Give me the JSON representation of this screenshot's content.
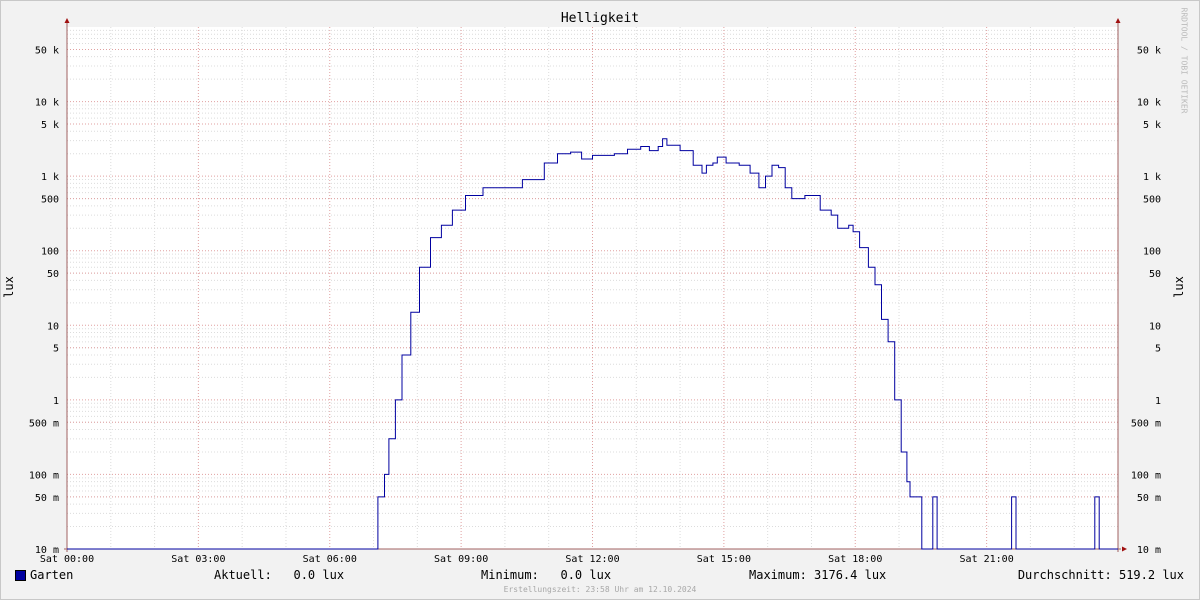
{
  "chart_data": {
    "type": "line",
    "title": "Helligkeit",
    "ylabel": "lux",
    "y_scale": "log",
    "ylim": [
      0.01,
      100000
    ],
    "y_ticks": [
      {
        "v": 0.01,
        "label": "10 m"
      },
      {
        "v": 0.05,
        "label": "50 m"
      },
      {
        "v": 0.1,
        "label": "100 m"
      },
      {
        "v": 0.5,
        "label": "500 m"
      },
      {
        "v": 1,
        "label": "1"
      },
      {
        "v": 5,
        "label": "5"
      },
      {
        "v": 10,
        "label": "10"
      },
      {
        "v": 50,
        "label": "50"
      },
      {
        "v": 100,
        "label": "100"
      },
      {
        "v": 500,
        "label": "500"
      },
      {
        "v": 1000,
        "label": "1 k"
      },
      {
        "v": 5000,
        "label": "5 k"
      },
      {
        "v": 10000,
        "label": "10 k"
      },
      {
        "v": 50000,
        "label": "50 k"
      }
    ],
    "x_unit": "hours",
    "xlim": [
      0,
      24
    ],
    "x_ticks": [
      {
        "v": 0,
        "label": "Sat 00:00"
      },
      {
        "v": 3,
        "label": "Sat 03:00"
      },
      {
        "v": 6,
        "label": "Sat 06:00"
      },
      {
        "v": 9,
        "label": "Sat 09:00"
      },
      {
        "v": 12,
        "label": "Sat 12:00"
      },
      {
        "v": 15,
        "label": "Sat 15:00"
      },
      {
        "v": 18,
        "label": "Sat 18:00"
      },
      {
        "v": 21,
        "label": "Sat 21:00"
      }
    ],
    "grid": true,
    "series": [
      {
        "name": "Garten",
        "color": "#0000a0",
        "points": [
          [
            0,
            0.01
          ],
          [
            7.08,
            0.01
          ],
          [
            7.1,
            0.05
          ],
          [
            7.2,
            0.05
          ],
          [
            7.25,
            0.1
          ],
          [
            7.35,
            0.3
          ],
          [
            7.5,
            1
          ],
          [
            7.65,
            4
          ],
          [
            7.85,
            15
          ],
          [
            8.05,
            60
          ],
          [
            8.3,
            150
          ],
          [
            8.55,
            220
          ],
          [
            8.8,
            350
          ],
          [
            9.1,
            550
          ],
          [
            9.5,
            700
          ],
          [
            10,
            700
          ],
          [
            10.4,
            900
          ],
          [
            10.9,
            1500
          ],
          [
            11.2,
            2000
          ],
          [
            11.5,
            2100
          ],
          [
            11.75,
            1700
          ],
          [
            12,
            1900
          ],
          [
            12.5,
            2000
          ],
          [
            12.8,
            2300
          ],
          [
            13.1,
            2500
          ],
          [
            13.3,
            2200
          ],
          [
            13.5,
            2500
          ],
          [
            13.6,
            3176
          ],
          [
            13.7,
            2600
          ],
          [
            14,
            2200
          ],
          [
            14.3,
            1400
          ],
          [
            14.5,
            1100
          ],
          [
            14.6,
            1400
          ],
          [
            14.75,
            1500
          ],
          [
            14.85,
            1800
          ],
          [
            15.05,
            1500
          ],
          [
            15.35,
            1400
          ],
          [
            15.6,
            1100
          ],
          [
            15.8,
            700
          ],
          [
            15.95,
            1000
          ],
          [
            16.1,
            1400
          ],
          [
            16.25,
            1300
          ],
          [
            16.4,
            700
          ],
          [
            16.55,
            500
          ],
          [
            16.85,
            550
          ],
          [
            17.2,
            350
          ],
          [
            17.45,
            300
          ],
          [
            17.6,
            200
          ],
          [
            17.85,
            220
          ],
          [
            17.95,
            180
          ],
          [
            18.1,
            110
          ],
          [
            18.3,
            60
          ],
          [
            18.45,
            35
          ],
          [
            18.6,
            12
          ],
          [
            18.75,
            6
          ],
          [
            18.9,
            1
          ],
          [
            19.05,
            0.2
          ],
          [
            19.18,
            0.08
          ],
          [
            19.25,
            0.05
          ],
          [
            19.5,
            0.05
          ],
          [
            19.52,
            0.01
          ],
          [
            19.75,
            0.01
          ],
          [
            19.77,
            0.05
          ],
          [
            19.85,
            0.05
          ],
          [
            19.87,
            0.01
          ],
          [
            21.55,
            0.01
          ],
          [
            21.57,
            0.05
          ],
          [
            21.65,
            0.05
          ],
          [
            21.67,
            0.01
          ],
          [
            23.45,
            0.01
          ],
          [
            23.47,
            0.05
          ],
          [
            23.55,
            0.05
          ],
          [
            23.57,
            0.01
          ],
          [
            24,
            0.01
          ]
        ]
      }
    ]
  },
  "legend": {
    "label": "Garten",
    "color": "#0000a0"
  },
  "stats": {
    "aktuell": "Aktuell:   0.0 lux",
    "minimum": "Minimum:   0.0 lux",
    "maximum": "Maximum: 3176.4 lux",
    "durchschnitt": "Durchschnitt: 519.2 lux"
  },
  "footer": "Erstellungszeit: 23:58 Uhr am 12.10.2024",
  "watermark": "RRDTOOL / TOBI OETIKER"
}
